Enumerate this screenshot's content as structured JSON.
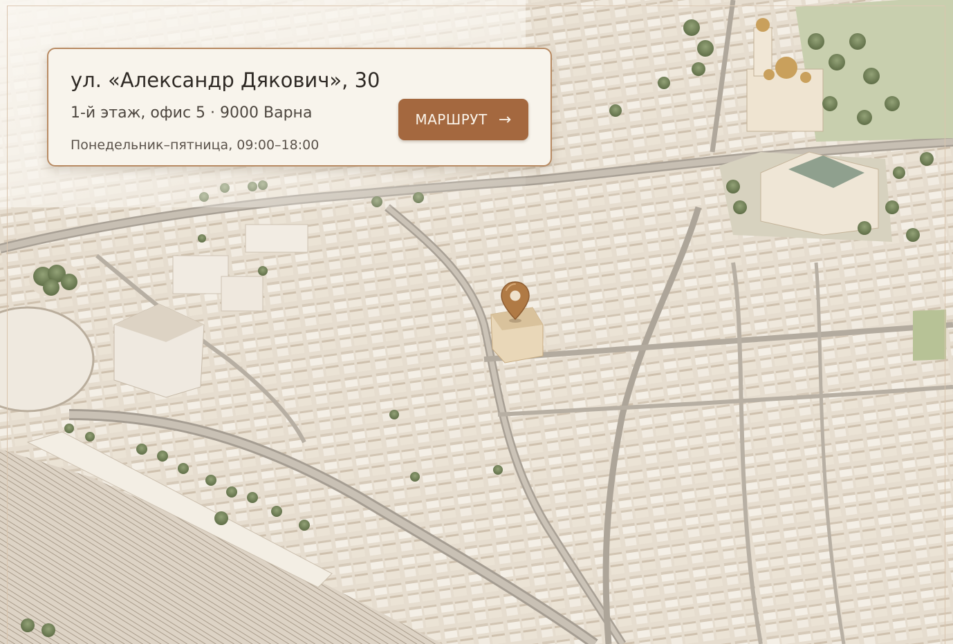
{
  "address_card": {
    "street": "ул. «Александр Дякович», 30",
    "office": "1-й этаж, офис 5 · 9000 Варна",
    "hours": "Понедельник–пятница, 09:00–18:00",
    "route_label": "МАРШРУТ",
    "route_icon": "arrow-right-icon"
  },
  "map": {
    "pin_icon": "map-pin-icon",
    "colors": {
      "accent": "#a4683f",
      "pin": "#b07a45",
      "card_border": "#b88a62",
      "card_bg": "#f8f4ec"
    }
  }
}
